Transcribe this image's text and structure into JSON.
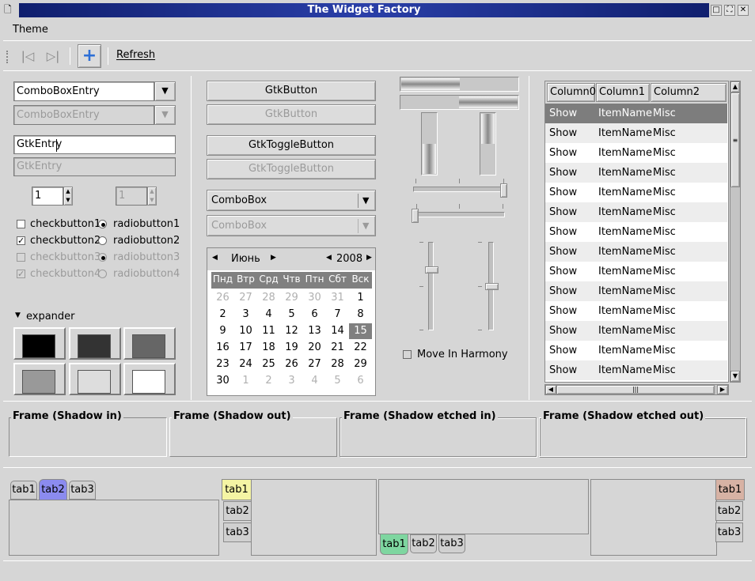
{
  "window": {
    "title": "The Widget Factory",
    "buttons": [
      "□",
      "⛶",
      "✕"
    ]
  },
  "menubar": {
    "items": [
      "Theme"
    ]
  },
  "toolbar": {
    "first_label": "|◁",
    "last_label": "▷|",
    "add_label": "+",
    "refresh_label": "Refresh",
    "refresh_mnemonic": "R"
  },
  "left": {
    "combo_entry": "ComboBoxEntry",
    "combo_entry_disabled": "ComboBoxEntry",
    "entry": "GtkEntry",
    "entry_disabled": "GtkEntry",
    "spin": "1",
    "spin_disabled": "1",
    "checks": [
      {
        "label": "checkbutton1",
        "checked": false,
        "disabled": false
      },
      {
        "label": "checkbutton2",
        "checked": true,
        "disabled": false
      },
      {
        "label": "checkbutton3",
        "checked": false,
        "disabled": true
      },
      {
        "label": "checkbutton4",
        "checked": true,
        "disabled": true
      }
    ],
    "radios": [
      {
        "label": "radiobutton1",
        "selected": true,
        "disabled": false
      },
      {
        "label": "radiobutton2",
        "selected": false,
        "disabled": false
      },
      {
        "label": "radiobutton3",
        "selected": true,
        "disabled": true
      },
      {
        "label": "radiobutton4",
        "selected": false,
        "disabled": true
      }
    ],
    "expander": "expander",
    "swatches": [
      "#000000",
      "#333333",
      "#666666",
      "#999999",
      "#dddddd",
      "#ffffff"
    ]
  },
  "middle": {
    "button": "GtkButton",
    "button_disabled": "GtkButton",
    "toggle": "GtkToggleButton",
    "toggle_disabled": "GtkToggleButton",
    "combo": "ComboBox",
    "combo_disabled": "ComboBox",
    "calendar": {
      "month": "Июнь",
      "year": "2008",
      "weekdays": [
        "Пнд",
        "Втр",
        "Срд",
        "Чтв",
        "Птн",
        "Сбт",
        "Вск"
      ],
      "weeks": [
        [
          [
            "26",
            1
          ],
          [
            "27",
            1
          ],
          [
            "28",
            1
          ],
          [
            "29",
            1
          ],
          [
            "30",
            1
          ],
          [
            "31",
            1
          ],
          [
            "1",
            0
          ]
        ],
        [
          [
            "2",
            0
          ],
          [
            "3",
            0
          ],
          [
            "4",
            0
          ],
          [
            "5",
            0
          ],
          [
            "6",
            0
          ],
          [
            "7",
            0
          ],
          [
            "8",
            0
          ]
        ],
        [
          [
            "9",
            0
          ],
          [
            "10",
            0
          ],
          [
            "11",
            0
          ],
          [
            "12",
            0
          ],
          [
            "13",
            0
          ],
          [
            "14",
            0
          ],
          [
            "15",
            2
          ]
        ],
        [
          [
            "16",
            0
          ],
          [
            "17",
            0
          ],
          [
            "18",
            0
          ],
          [
            "19",
            0
          ],
          [
            "20",
            0
          ],
          [
            "21",
            0
          ],
          [
            "22",
            0
          ]
        ],
        [
          [
            "23",
            0
          ],
          [
            "24",
            0
          ],
          [
            "25",
            0
          ],
          [
            "26",
            0
          ],
          [
            "27",
            0
          ],
          [
            "28",
            0
          ],
          [
            "29",
            0
          ]
        ],
        [
          [
            "30",
            0
          ],
          [
            "1",
            1
          ],
          [
            "2",
            1
          ],
          [
            "3",
            1
          ],
          [
            "4",
            1
          ],
          [
            "5",
            1
          ],
          [
            "6",
            1
          ]
        ]
      ]
    }
  },
  "ranges": {
    "hprogress": [
      0.5,
      0.5
    ],
    "vprogress": [
      0.5,
      0.5
    ],
    "hscale": [
      1.0,
      0.0
    ],
    "vscale": [
      0.3,
      0.5
    ],
    "harmony_label": "Move In Harmony",
    "harmony_checked": false
  },
  "tree": {
    "columns": [
      "Column0",
      "Column1",
      "Column2"
    ],
    "rows": [
      [
        "Show",
        "ItemName",
        "Misc"
      ],
      [
        "Show",
        "ItemName",
        "Misc"
      ],
      [
        "Show",
        "ItemName",
        "Misc"
      ],
      [
        "Show",
        "ItemName",
        "Misc"
      ],
      [
        "Show",
        "ItemName",
        "Misc"
      ],
      [
        "Show",
        "ItemName",
        "Misc"
      ],
      [
        "Show",
        "ItemName",
        "Misc"
      ],
      [
        "Show",
        "ItemName",
        "Misc"
      ],
      [
        "Show",
        "ItemName",
        "Misc"
      ],
      [
        "Show",
        "ItemName",
        "Misc"
      ],
      [
        "Show",
        "ItemName",
        "Misc"
      ],
      [
        "Show",
        "ItemName",
        "Misc"
      ],
      [
        "Show",
        "ItemName",
        "Misc"
      ],
      [
        "Show",
        "ItemName",
        "Misc"
      ]
    ],
    "selected_row": 0
  },
  "frames": [
    "Frame (Shadow in)",
    "Frame (Shadow out)",
    "Frame (Shadow etched in)",
    "Frame (Shadow etched out)"
  ],
  "notebooks": {
    "tabs": [
      "tab1",
      "tab2",
      "tab3"
    ],
    "active_colors": [
      "#8b8bef",
      "#f4f4a4",
      "#7ed6a0",
      "#d7b2a4"
    ]
  }
}
